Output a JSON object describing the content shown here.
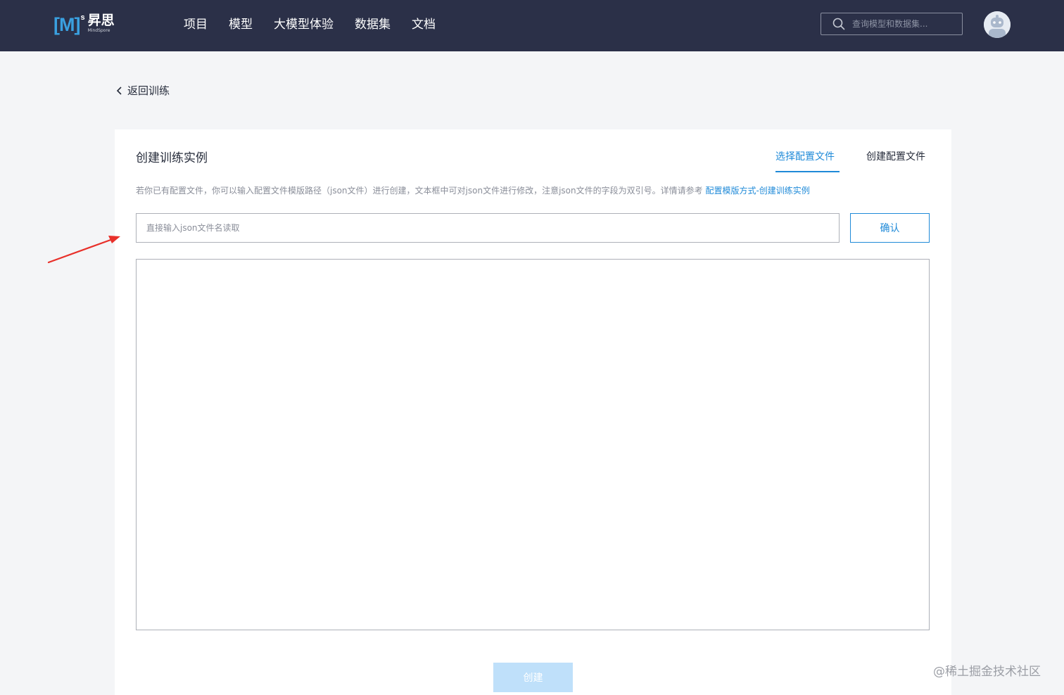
{
  "header": {
    "logo": {
      "mark": "[M]",
      "superscript": "s",
      "name_cn": "昇思",
      "name_en": "MindSpore"
    },
    "nav": [
      "项目",
      "模型",
      "大模型体验",
      "数据集",
      "文档"
    ],
    "search": {
      "placeholder": "查询模型和数据集..."
    }
  },
  "back_link": {
    "label": "返回训练"
  },
  "card": {
    "title": "创建训练实例",
    "tabs": [
      {
        "label": "选择配置文件",
        "active": true
      },
      {
        "label": "创建配置文件",
        "active": false
      }
    ],
    "tip": "若你已有配置文件，你可以输入配置文件模版路径（json文件）进行创建，文本框中可对json文件进行修改，注意json文件的字段为双引号。详情请参考",
    "tip_link": "配置模版方式-创建训练实例",
    "path_input": {
      "placeholder": "直接输入json文件名读取",
      "value": ""
    },
    "confirm_label": "确认",
    "json_editor": {
      "value": ""
    },
    "create_label": "创建"
  },
  "watermark": "@稀土掘金技术社区",
  "colors": {
    "topbar": "#2b3048",
    "accent": "#1f8ad8",
    "disabled_button": "#bfe0fa",
    "annotation_arrow": "#e8302a"
  }
}
